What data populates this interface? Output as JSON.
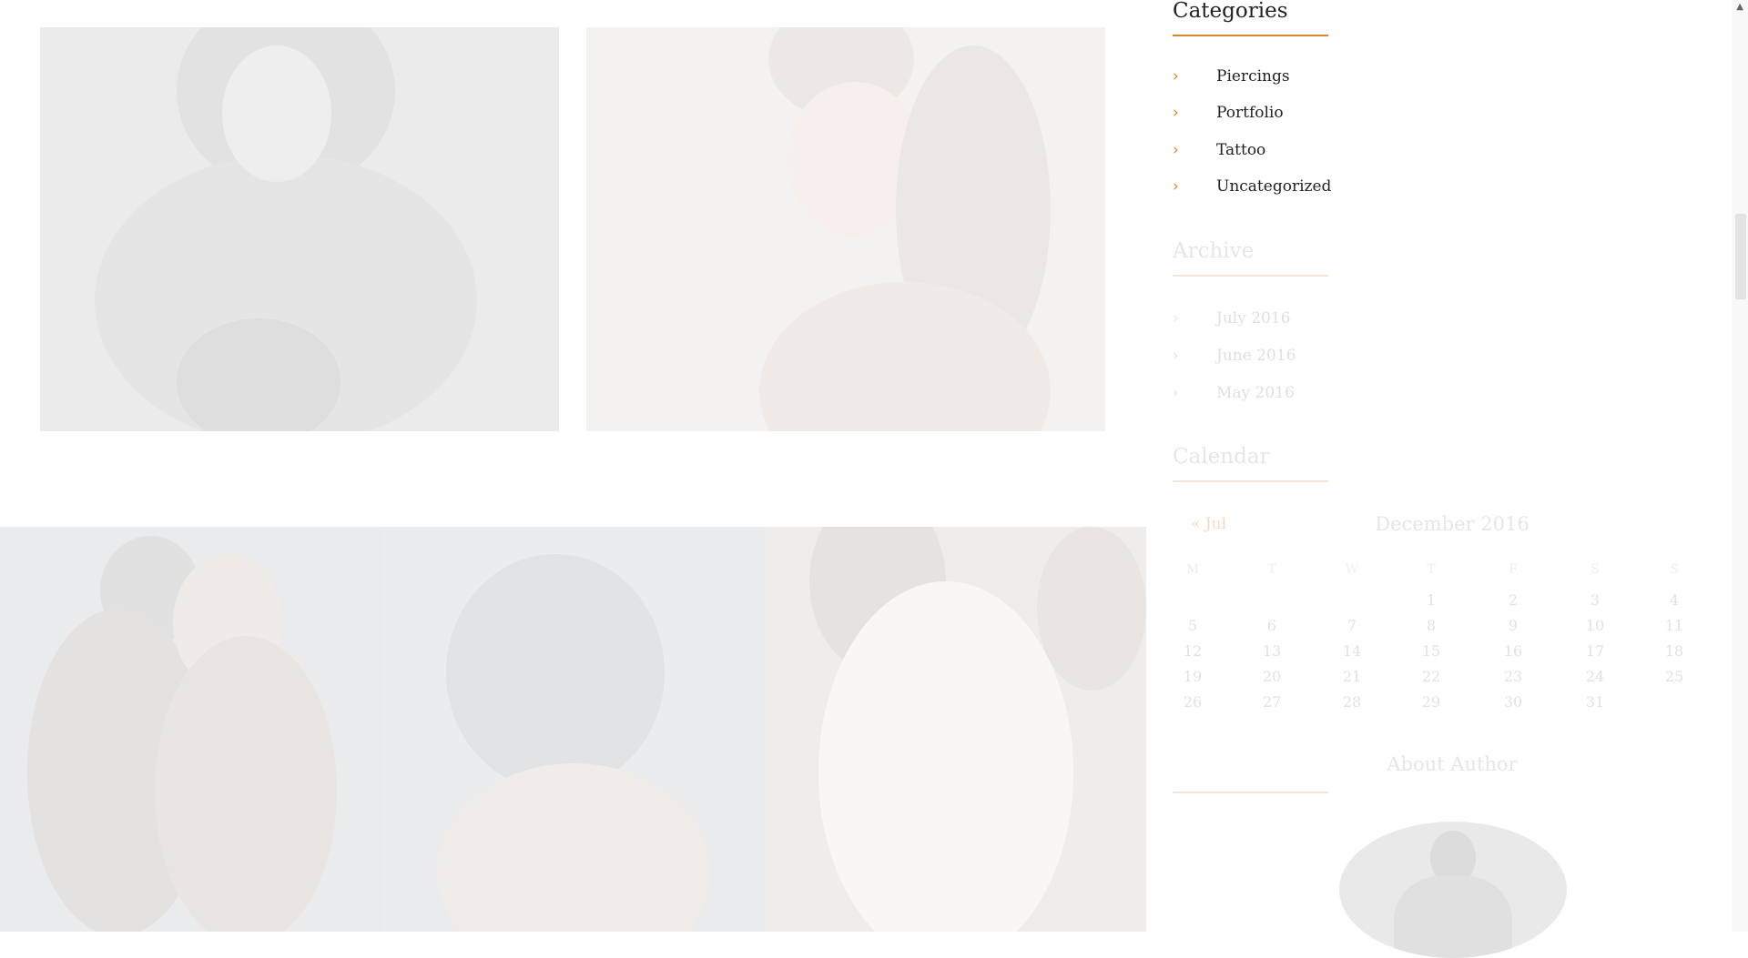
{
  "gallery": {
    "top_photos": [
      {
        "alt": "tattooed-woman-reclining-photo"
      },
      {
        "alt": "woman-with-ear-piercing-photo"
      }
    ],
    "bottom_photos": [
      {
        "alt": "tattooed-couple-photo"
      },
      {
        "alt": "man-with-long-hair-photo"
      },
      {
        "alt": "woman-white-tank-top-photo"
      }
    ]
  },
  "sidebar": {
    "categories": {
      "title": "Categories",
      "items": [
        {
          "label": "Piercings"
        },
        {
          "label": "Portfolio"
        },
        {
          "label": "Tattoo"
        },
        {
          "label": "Uncategorized"
        }
      ]
    },
    "archive": {
      "title": "Archive",
      "items": [
        {
          "label": "July 2016"
        },
        {
          "label": "June 2016"
        },
        {
          "label": "May 2016"
        }
      ]
    },
    "calendar": {
      "title": "Calendar",
      "prev_link": "« Jul",
      "month": "December 2016",
      "weekdays": [
        "M",
        "T",
        "W",
        "T",
        "F",
        "S",
        "S"
      ],
      "weeks": [
        [
          "",
          "",
          "",
          "1",
          "2",
          "3",
          "4"
        ],
        [
          "5",
          "6",
          "7",
          "8",
          "9",
          "10",
          "11"
        ],
        [
          "12",
          "13",
          "14",
          "15",
          "16",
          "17",
          "18"
        ],
        [
          "19",
          "20",
          "21",
          "22",
          "23",
          "24",
          "25"
        ],
        [
          "26",
          "27",
          "28",
          "29",
          "30",
          "31",
          ""
        ]
      ]
    },
    "about": {
      "title": "About Author"
    }
  },
  "colors": {
    "accent": "#d48a2c",
    "text": "#222222",
    "faded_text": "#e0e0e0",
    "background": "#ffffff"
  },
  "icons": {
    "list_bullet": "chevron-right-icon",
    "scroll_up": "arrow-up-icon"
  }
}
